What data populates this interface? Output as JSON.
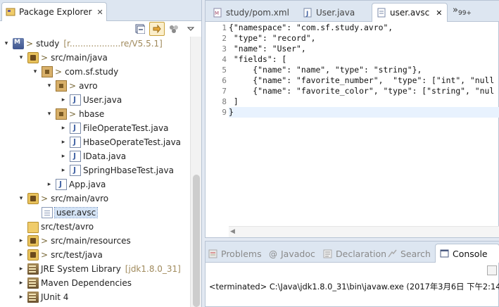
{
  "package_explorer": {
    "title": "Package Explorer",
    "tree": [
      {
        "id": "study",
        "label": "study",
        "deco": ">",
        "extra": "[r...................re/V5.5.1]",
        "icon": "maven-project-icon",
        "twisty": "▾"
      },
      {
        "id": "src-main-java",
        "label": "src/main/java",
        "deco": ">",
        "icon": "source-folder-icon",
        "twisty": "▾"
      },
      {
        "id": "com-sf-study",
        "label": "com.sf.study",
        "deco": ">",
        "icon": "package-icon",
        "twisty": "▾"
      },
      {
        "id": "avro",
        "label": "avro",
        "deco": ">",
        "icon": "package-icon",
        "twisty": "▾"
      },
      {
        "id": "user-java",
        "label": "User.java",
        "icon": "java-file-icon",
        "twisty": "▸"
      },
      {
        "id": "hbase",
        "label": "hbase",
        "deco": ">",
        "icon": "package-icon",
        "twisty": "▾"
      },
      {
        "id": "fileoperatetest",
        "label": "FileOperateTest.java",
        "icon": "java-file-icon",
        "twisty": "▸"
      },
      {
        "id": "hbaseoperatetest",
        "label": "HbaseOperateTest.java",
        "icon": "java-file-icon",
        "twisty": "▸"
      },
      {
        "id": "idata",
        "label": "IData.java",
        "icon": "java-file-icon",
        "twisty": "▸"
      },
      {
        "id": "springhbasetest",
        "label": "SpringHbaseTest.java",
        "icon": "java-file-icon",
        "twisty": "▸"
      },
      {
        "id": "app-java",
        "label": "App.java",
        "icon": "java-file-icon",
        "twisty": "▸"
      },
      {
        "id": "src-main-avro",
        "label": "src/main/avro",
        "deco": ">",
        "icon": "source-folder-icon",
        "twisty": "▾"
      },
      {
        "id": "user-avsc",
        "label": "user.avsc",
        "icon": "file-icon",
        "twisty": ""
      },
      {
        "id": "src-test-avro",
        "label": "src/test/avro",
        "icon": "folder-icon",
        "twisty": ""
      },
      {
        "id": "src-main-resources",
        "label": "src/main/resources",
        "deco": ">",
        "icon": "source-folder-icon",
        "twisty": "▸"
      },
      {
        "id": "src-test-java",
        "label": "src/test/java",
        "deco": ">",
        "icon": "source-folder-icon",
        "twisty": "▸"
      },
      {
        "id": "jre",
        "label": "JRE System Library",
        "extra": "[jdk1.8.0_31]",
        "icon": "library-icon",
        "twisty": "▸"
      },
      {
        "id": "maven-deps",
        "label": "Maven Dependencies",
        "icon": "library-icon",
        "twisty": "▸"
      },
      {
        "id": "junit",
        "label": "JUnit 4",
        "icon": "library-icon",
        "twisty": "▸"
      }
    ]
  },
  "editor": {
    "tabs": [
      {
        "label": "study/pom.xml",
        "icon": "xml-file-icon",
        "active": false
      },
      {
        "label": "User.java",
        "icon": "java-file-icon",
        "active": false
      },
      {
        "label": "user.avsc",
        "icon": "file-icon",
        "active": true
      }
    ],
    "overflow_label": "»",
    "overflow_count": "99+",
    "line_numbers": [
      "1",
      "2",
      "3",
      "4",
      "5",
      "6",
      "7",
      "8",
      "9"
    ],
    "lines": [
      "{\"namespace\": \"com.sf.study.avro\",",
      " \"type\": \"record\",",
      " \"name\": \"User\",",
      " \"fields\": [",
      "     {\"name\": \"name\", \"type\": \"string\"},",
      "     {\"name\": \"favorite_number\",  \"type\": [\"int\", \"null",
      "     {\"name\": \"favorite_color\", \"type\": [\"string\", \"nul",
      " ]",
      "}"
    ]
  },
  "console": {
    "tabs": [
      {
        "label": "Problems",
        "icon": "problems-icon"
      },
      {
        "label": "Javadoc",
        "icon": "javadoc-icon"
      },
      {
        "label": "Declaration",
        "icon": "declaration-icon"
      },
      {
        "label": "Search",
        "icon": "search-icon"
      },
      {
        "label": "Console",
        "icon": "console-icon",
        "active": true
      }
    ],
    "output": "<terminated> C:\\Java\\jdk1.8.0_31\\bin\\javaw.exe (2017年3月6日 下午2:14"
  }
}
